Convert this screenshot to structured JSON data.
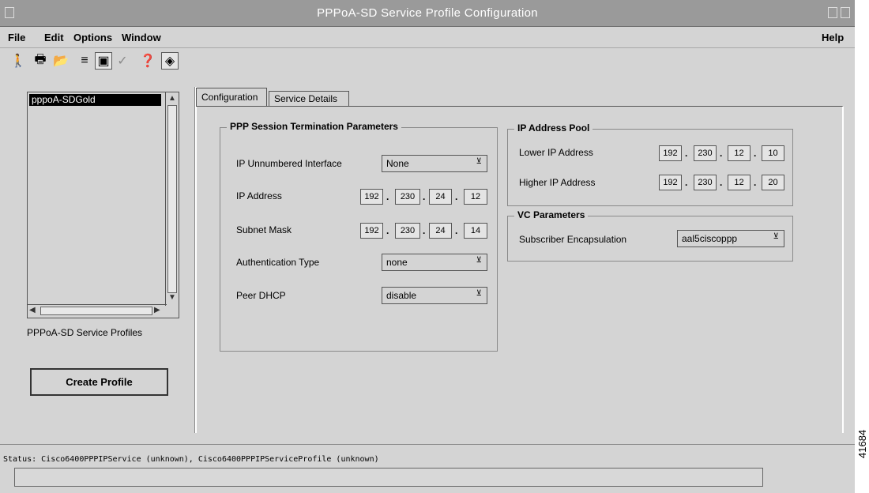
{
  "window": {
    "title": "PPPoA-SD Service Profile Configuration"
  },
  "menu": {
    "file": "File",
    "edit": "Edit",
    "options": "Options",
    "window": "Window",
    "help": "Help"
  },
  "toolbar": {
    "icons": [
      "exit-icon",
      "print-icon",
      "open-folder-icon",
      "list-icon",
      "monitor-icon",
      "checkmark-icon",
      "help-icon",
      "refresh-icon"
    ]
  },
  "profiles": {
    "items": [
      "pppoA-SDGold"
    ],
    "caption": "PPPoA-SD Service Profiles",
    "create_label": "Create Profile"
  },
  "tabs": [
    "Configuration",
    "Service Details"
  ],
  "ppp": {
    "title": "PPP Session Termination Parameters",
    "ip_unnumbered_label": "IP Unnumbered Interface",
    "ip_unnumbered_value": "None",
    "ip_address_label": "IP Address",
    "ip_address": [
      "192",
      "230",
      "24",
      "12"
    ],
    "subnet_label": "Subnet Mask",
    "subnet": [
      "192",
      "230",
      "24",
      "14"
    ],
    "auth_label": "Authentication Type",
    "auth_value": "none",
    "peer_dhcp_label": "Peer DHCP",
    "peer_dhcp_value": "disable"
  },
  "pool": {
    "title": "IP Address Pool",
    "lower_label": "Lower IP Address",
    "lower": [
      "192",
      "230",
      "12",
      "10"
    ],
    "higher_label": "Higher IP Address",
    "higher": [
      "192",
      "230",
      "12",
      "20"
    ]
  },
  "vc": {
    "title": "VC Parameters",
    "encap_label": "Subscriber Encapsulation",
    "encap_value": "aal5ciscoppp"
  },
  "status": {
    "text": "Status: Cisco6400PPPIPService (unknown), Cisco6400PPPIPServiceProfile (unknown)"
  },
  "side_label": "41684"
}
